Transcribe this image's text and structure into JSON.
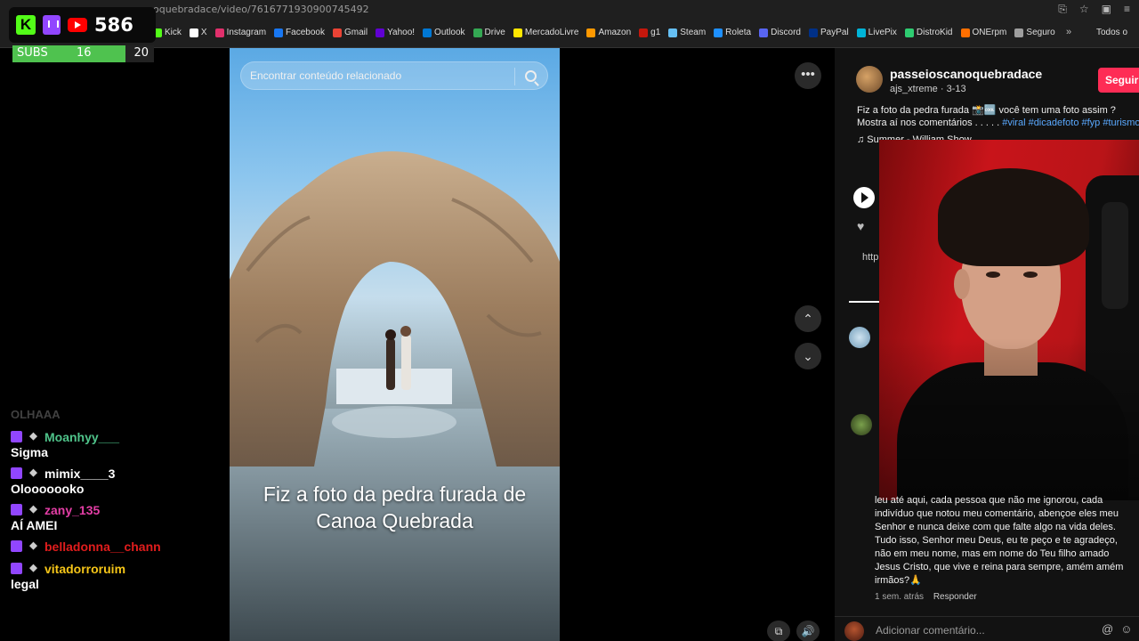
{
  "browser": {
    "url": "oquebradace/video/7616771930900745492",
    "bookmarks": [
      {
        "label": "Kick",
        "color": "#53fc18"
      },
      {
        "label": "X",
        "color": "#ffffff"
      },
      {
        "label": "Instagram",
        "color": "#e1306c"
      },
      {
        "label": "Facebook",
        "color": "#1877f2"
      },
      {
        "label": "Gmail",
        "color": "#ea4335"
      },
      {
        "label": "Yahoo!",
        "color": "#6001d2"
      },
      {
        "label": "Outlook",
        "color": "#0078d4"
      },
      {
        "label": "Drive",
        "color": "#34a853"
      },
      {
        "label": "MercadoLivre",
        "color": "#ffe600"
      },
      {
        "label": "Amazon",
        "color": "#ff9900"
      },
      {
        "label": "g1",
        "color": "#c4170c"
      },
      {
        "label": "Steam",
        "color": "#66c0f4"
      },
      {
        "label": "Roleta",
        "color": "#1e90ff"
      },
      {
        "label": "Discord",
        "color": "#5865f2"
      },
      {
        "label": "PayPal",
        "color": "#003087"
      },
      {
        "label": "LivePix",
        "color": "#00b4d8"
      },
      {
        "label": "DistroKid",
        "color": "#2ecc71"
      },
      {
        "label": "ONErpm",
        "color": "#ff6f00"
      },
      {
        "label": "Seguro",
        "color": "#9e9e9e"
      }
    ],
    "more": "»",
    "folder": "Todos o"
  },
  "overlay": {
    "viewers": "586",
    "subs": {
      "label": "SUBS",
      "current": "16",
      "goal": "20",
      "progress": 0.8
    }
  },
  "chat": {
    "faded": "OLHAAA",
    "lines": [
      {
        "user": "Moanhyy___",
        "color": "#4fc38a",
        "message": "Sigma"
      },
      {
        "user": "mimix____3",
        "color": "#ffffff",
        "message": "Olooooooko"
      },
      {
        "user": "zany_135",
        "color": "#e43ea6",
        "message": "AÍ AMEI"
      },
      {
        "user": "belladonna__chann",
        "color": "#e11d1d",
        "message": ""
      },
      {
        "user": "vitadorroruim",
        "color": "#f5c518",
        "message": "legal"
      }
    ]
  },
  "video": {
    "search_placeholder": "Encontrar conteúdo relacionado",
    "caption_line1": "Fiz a foto da pedra furada de",
    "caption_line2": "Canoa Quebrada"
  },
  "post": {
    "author": "passeioscanoquebradace",
    "meta": "ajs_xtreme · 3-13",
    "follow": "Seguir",
    "desc_text": "Fiz a foto da pedra furada 📸🆒 você tem uma foto assim ? Mostra aí nos comentários . . . . .",
    "hashtags": "#viral #dicadefoto #fyp #turismo",
    "music": "♫  Summer - William Show",
    "link_snippet": "http"
  },
  "comment": {
    "text": "leu até aqui, cada pessoa que não me ignorou, cada indivíduo que notou meu comentário, abençoe eles meu Senhor e nunca deixe com que falte algo na vida deles. Tudo isso, Senhor meu Deus, eu te peço e te agradeço, não em meu nome, mas em nome do Teu filho amado Jesus Cristo, que vive e reina para sempre, amém amém irmãos?🙏",
    "time": "1 sem. atrás",
    "reply": "Responder"
  },
  "add_comment_placeholder": "Adicionar comentário..."
}
